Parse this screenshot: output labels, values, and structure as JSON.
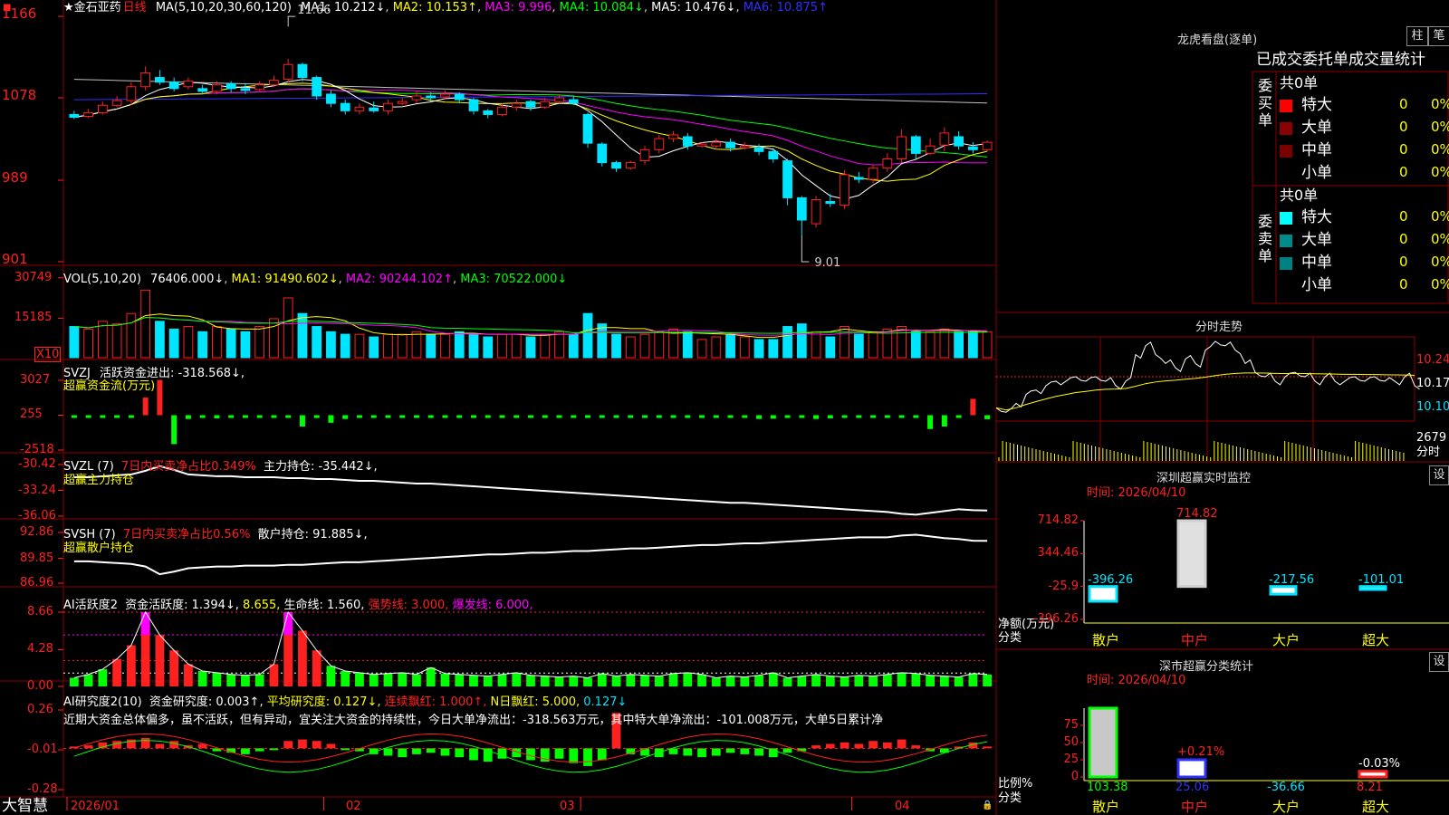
{
  "stock": {
    "star": "★",
    "name": "金石亚药",
    "period": "日线"
  },
  "colors": {
    "up": "#ff2020",
    "down": "#00e5ff",
    "green": "#00ff00",
    "white": "#ffffff",
    "yellow": "#ffff00",
    "magenta": "#ff00ff",
    "blue": "#3030ff",
    "grid": "#8b0000",
    "gray": "#c0c0c0"
  },
  "price_panel": {
    "ma_title": "MA(5,10,20,30,60,120)",
    "ma1": "MA1: 10.212↓",
    "ma2": "MA2: 10.153↑",
    "ma3": "MA3: 9.996",
    "ma4": "MA4: 10.084↓",
    "ma5": "MA5: 10.476↓",
    "ma6": "MA6: 10.875↑",
    "yticks": [
      "1166",
      "1078",
      "989",
      "901"
    ],
    "high_label": "11.66",
    "low_label": "9.01"
  },
  "vol_panel": {
    "title": "VOL(5,10,20)",
    "value": "76406.000↓",
    "ma1": "MA1: 91490.602↓",
    "ma2": "MA2: 90244.102↑",
    "ma3": "MA3: 70522.000↓",
    "yticks": [
      "30749",
      "15185"
    ],
    "unit": "X10"
  },
  "svzj_panel": {
    "title": "SVZJ",
    "label": "活跃资金进出: -318.568↓,",
    "sub": "超赢资金流(万元)",
    "yticks": [
      "3027",
      "255",
      "-2518"
    ]
  },
  "svzl_panel": {
    "title": "SVZL (7)",
    "label1": "7日内买卖净占比0.349%",
    "label2": "主力持仓: -35.442↓,",
    "sub": "超赢主力持仓",
    "yticks": [
      "-30.42",
      "-33.24",
      "-36.06"
    ]
  },
  "svsh_panel": {
    "title": "SVSH (7)",
    "label1": "7日内买卖净占比0.56%",
    "label2": "散户持仓: 91.885↓,",
    "sub": "超赢散户持仓",
    "yticks": [
      "92.86",
      "89.85",
      "86.96"
    ]
  },
  "ai_act_panel": {
    "title": "AI活跃度2",
    "l1": "资金活跃度: 1.394↓,",
    "l2": "8.655,",
    "l3": "生命线: 1.560,",
    "l4": "强势线: 3.000,",
    "l5": "爆发线: 6.000,",
    "yticks": [
      "8.66",
      "4.28",
      "0.00"
    ]
  },
  "ai_res_panel": {
    "title": "AI研究度2(10)",
    "l1": "资金研究度: 0.003↑,",
    "l2": "平均研究度: 0.127↓,",
    "l3": "连续飘红: 1.000↑,",
    "l4": "N日飘红: 5.000,",
    "l5": "0.127↓",
    "comment": "近期大资金总体偏多，虽不活跃，但有异动，宜关注大资金的持续性，今日大单净流出：-318.563万元，其中特大单净流出：-101.008万元，大单5日累计净",
    "yticks": [
      "0.26",
      "-0.01",
      "-0.28"
    ]
  },
  "xaxis": {
    "brand": "大智慧",
    "labels": [
      "2026/01",
      "02",
      "03",
      "04"
    ]
  },
  "longhu": {
    "title": "龙虎看盘(逐单)",
    "btn_bar": "柱",
    "btn_pen": "笔",
    "header": "已成交委托单成交量统计",
    "buy": {
      "side": "委买单",
      "total": "共0单",
      "rows": [
        {
          "label": "特大",
          "n": "0",
          "p": "0%"
        },
        {
          "label": "大单",
          "n": "0",
          "p": "0%"
        },
        {
          "label": "中单",
          "n": "0",
          "p": "0%"
        },
        {
          "label": "小单",
          "n": "0",
          "p": "0%"
        }
      ]
    },
    "sell": {
      "side": "委卖单",
      "total": "共0单",
      "rows": [
        {
          "label": "特大",
          "n": "0",
          "p": "0%"
        },
        {
          "label": "大单",
          "n": "0",
          "p": "0%"
        },
        {
          "label": "中单",
          "n": "0",
          "p": "0%"
        },
        {
          "label": "小单",
          "n": "0",
          "p": "0%"
        }
      ]
    }
  },
  "intraday": {
    "title": "分时走势",
    "yticks": [
      "10.24",
      "10.17",
      "10.10"
    ],
    "vol_label": "2679",
    "vol_unit": "分时"
  },
  "monitor": {
    "title": "深圳超赢实时监控",
    "set": "设",
    "time": "时间: 2026/04/10",
    "yticks": [
      "714.82",
      "344.46",
      "-25.9",
      "-396.26"
    ],
    "ylabel": "净额(万元)",
    "xlabel": "分类",
    "bars": [
      {
        "cat": "散户",
        "value": "-396.26"
      },
      {
        "cat": "中户",
        "value": "714.82"
      },
      {
        "cat": "大户",
        "value": "-217.56"
      },
      {
        "cat": "超大",
        "value": "-101.01"
      }
    ]
  },
  "classify": {
    "title": "深市超赢分类统计",
    "set": "设",
    "time": "时间: 2026/04/10",
    "yticks": [
      "75",
      "50",
      "25",
      "0"
    ],
    "ylabel": "比例%",
    "xlabel": "分类",
    "bars": [
      {
        "cat": "散户",
        "value": "103.38",
        "delta": ""
      },
      {
        "cat": "中户",
        "value": "25.06",
        "delta": "+0.21%"
      },
      {
        "cat": "大户",
        "value": "-36.66",
        "delta": ""
      },
      {
        "cat": "超大",
        "value": "8.21",
        "delta": "-0.03%"
      }
    ]
  },
  "chart_data": {
    "type": "candlestick",
    "candles": [
      [
        10.6,
        10.57,
        10.64,
        10.55
      ],
      [
        10.58,
        10.62,
        10.66,
        10.56
      ],
      [
        10.62,
        10.7,
        10.74,
        10.6
      ],
      [
        10.7,
        10.75,
        10.8,
        10.68
      ],
      [
        10.75,
        10.9,
        10.95,
        10.7
      ],
      [
        10.9,
        11.05,
        11.12,
        10.86
      ],
      [
        11.0,
        10.95,
        11.08,
        10.92
      ],
      [
        10.95,
        10.88,
        11.0,
        10.85
      ],
      [
        10.9,
        10.96,
        11.0,
        10.87
      ],
      [
        10.88,
        10.85,
        10.92,
        10.82
      ],
      [
        10.85,
        10.92,
        10.96,
        10.82
      ],
      [
        10.93,
        10.88,
        10.96,
        10.84
      ],
      [
        10.88,
        10.86,
        10.94,
        10.82
      ],
      [
        10.87,
        10.92,
        10.96,
        10.85
      ],
      [
        10.92,
        10.97,
        11.02,
        10.9
      ],
      [
        10.98,
        11.14,
        11.2,
        10.95
      ],
      [
        11.14,
        11.0,
        11.16,
        10.96
      ],
      [
        11.0,
        10.8,
        11.02,
        10.76
      ],
      [
        10.82,
        10.72,
        10.86,
        10.68
      ],
      [
        10.72,
        10.64,
        10.76,
        10.6
      ],
      [
        10.64,
        10.68,
        10.72,
        10.6
      ],
      [
        10.67,
        10.64,
        10.74,
        10.62
      ],
      [
        10.64,
        10.72,
        10.76,
        10.6
      ],
      [
        10.72,
        10.74,
        10.78,
        10.7
      ],
      [
        10.76,
        10.8,
        10.86,
        10.72
      ],
      [
        10.8,
        10.78,
        10.84,
        10.74
      ],
      [
        10.79,
        10.82,
        10.86,
        10.76
      ],
      [
        10.82,
        10.76,
        10.84,
        10.72
      ],
      [
        10.76,
        10.64,
        10.78,
        10.6
      ],
      [
        10.64,
        10.6,
        10.66,
        10.56
      ],
      [
        10.6,
        10.68,
        10.72,
        10.58
      ],
      [
        10.68,
        10.72,
        10.76,
        10.64
      ],
      [
        10.74,
        10.68,
        10.76,
        10.64
      ],
      [
        10.68,
        10.74,
        10.78,
        10.66
      ],
      [
        10.74,
        10.78,
        10.82,
        10.72
      ],
      [
        10.76,
        10.72,
        10.8,
        10.7
      ],
      [
        10.6,
        10.29,
        10.62,
        10.24
      ],
      [
        10.28,
        10.08,
        10.3,
        10.04
      ],
      [
        10.08,
        10.02,
        10.1,
        9.98
      ],
      [
        10.02,
        10.08,
        10.1,
        10.0
      ],
      [
        10.1,
        10.22,
        10.26,
        10.06
      ],
      [
        10.22,
        10.34,
        10.38,
        10.18
      ],
      [
        10.34,
        10.38,
        10.42,
        10.3
      ],
      [
        10.36,
        10.26,
        10.4,
        10.22
      ],
      [
        10.26,
        10.28,
        10.3,
        10.24
      ],
      [
        10.26,
        10.3,
        10.34,
        10.22
      ],
      [
        10.3,
        10.24,
        10.34,
        10.2
      ],
      [
        10.24,
        10.26,
        10.3,
        10.22
      ],
      [
        10.24,
        10.2,
        10.28,
        10.16
      ],
      [
        10.2,
        10.12,
        10.24,
        10.08
      ],
      [
        10.1,
        9.7,
        10.12,
        9.62
      ],
      [
        9.7,
        9.46,
        9.72,
        9.3
      ],
      [
        9.42,
        9.68,
        9.72,
        9.38
      ],
      [
        9.66,
        9.64,
        9.74,
        9.6
      ],
      [
        9.62,
        9.95,
        10.0,
        9.58
      ],
      [
        9.92,
        9.9,
        9.98,
        9.86
      ],
      [
        9.9,
        10.02,
        10.06,
        9.86
      ],
      [
        10.02,
        10.12,
        10.18,
        9.98
      ],
      [
        10.12,
        10.36,
        10.44,
        10.08
      ],
      [
        10.36,
        10.18,
        10.38,
        10.12
      ],
      [
        10.18,
        10.26,
        10.34,
        10.16
      ],
      [
        10.27,
        10.4,
        10.46,
        10.2
      ],
      [
        10.36,
        10.26,
        10.42,
        10.22
      ],
      [
        10.25,
        10.22,
        10.3,
        10.18
      ],
      [
        10.22,
        10.3,
        10.32,
        10.2
      ]
    ],
    "volume": [
      12,
      11,
      14,
      13,
      17,
      26,
      14,
      11,
      12,
      10,
      12,
      11,
      10,
      12,
      15,
      23,
      17,
      12,
      10,
      9,
      9,
      8,
      9,
      9,
      10,
      9,
      9,
      10,
      9,
      8,
      9,
      9,
      8,
      9,
      10,
      9,
      17,
      13,
      9,
      8,
      9,
      10,
      11,
      10,
      7,
      8,
      9,
      8,
      7,
      7,
      12,
      13,
      10,
      8,
      12,
      9,
      10,
      11,
      12,
      10,
      10,
      11,
      10,
      10,
      10
    ],
    "active_flow": [
      -50,
      -40,
      -30,
      -20,
      -10,
      1400,
      2800,
      -2300,
      -300,
      -200,
      -250,
      -200,
      -180,
      -150,
      -160,
      -180,
      -900,
      -220,
      -600,
      -300,
      -160,
      -150,
      -170,
      -180,
      -150,
      -160,
      -170,
      -150,
      -160,
      -180,
      -170,
      -160,
      -150,
      -170,
      -180,
      -160,
      -170,
      -150,
      -160,
      -200,
      -180,
      -160,
      -170,
      -150,
      -170,
      -160,
      -150,
      -160,
      -300,
      -280,
      -150,
      -200,
      -300,
      -250,
      -160,
      -200,
      -170,
      -160,
      -180,
      -170,
      -1100,
      -900,
      -150,
      1300,
      -318
    ],
    "svzl": [
      -31.8,
      -31.8,
      -31.7,
      -31.6,
      -31.5,
      -31.1,
      -30.6,
      -31.0,
      -31.5,
      -31.6,
      -31.7,
      -31.7,
      -31.8,
      -31.8,
      -31.8,
      -31.9,
      -31.9,
      -32.0,
      -32.0,
      -32.1,
      -32.2,
      -32.2,
      -32.3,
      -32.4,
      -32.5,
      -32.5,
      -32.6,
      -32.7,
      -32.8,
      -32.9,
      -33.0,
      -33.1,
      -33.2,
      -33.3,
      -33.4,
      -33.5,
      -33.6,
      -33.7,
      -33.8,
      -33.9,
      -34.0,
      -34.1,
      -34.2,
      -34.3,
      -34.4,
      -34.5,
      -34.6,
      -34.6,
      -34.7,
      -34.8,
      -34.9,
      -35.0,
      -35.1,
      -35.2,
      -35.3,
      -35.4,
      -35.5,
      -35.6,
      -35.8,
      -35.9,
      -35.7,
      -35.5,
      -35.3,
      -35.4,
      -35.44
    ],
    "svsh": [
      89.5,
      89.5,
      89.4,
      89.3,
      89.2,
      88.9,
      88.0,
      88.3,
      88.7,
      88.8,
      88.9,
      88.9,
      89.0,
      89.0,
      89.0,
      89.1,
      89.1,
      89.2,
      89.3,
      89.4,
      89.4,
      89.5,
      89.6,
      89.7,
      89.8,
      89.9,
      90.0,
      90.1,
      90.2,
      90.3,
      90.3,
      90.4,
      90.5,
      90.5,
      90.6,
      90.7,
      90.7,
      90.8,
      90.9,
      91.0,
      91.0,
      91.1,
      91.2,
      91.3,
      91.4,
      91.4,
      91.5,
      91.6,
      91.6,
      91.7,
      91.8,
      91.9,
      92.0,
      92.1,
      92.2,
      92.3,
      92.3,
      92.3,
      92.5,
      92.6,
      92.4,
      92.2,
      92.1,
      91.9,
      91.885
    ],
    "ai_activity": [
      1.0,
      1.4,
      2.0,
      3.2,
      4.8,
      8.66,
      6.0,
      4.2,
      2.6,
      1.8,
      1.6,
      1.4,
      1.3,
      1.4,
      2.6,
      8.66,
      6.5,
      4.2,
      2.4,
      1.8,
      1.6,
      1.4,
      1.5,
      1.6,
      1.4,
      2.2,
      1.5,
      1.4,
      1.3,
      1.2,
      1.4,
      1.6,
      1.3,
      1.2,
      1.1,
      1.2,
      1.0,
      1.5,
      1.2,
      1.4,
      1.3,
      1.2,
      1.5,
      1.6,
      1.4,
      1.0,
      1.2,
      1.1,
      1.3,
      1.6,
      1.0,
      1.2,
      1.4,
      1.2,
      1.1,
      1.3,
      1.2,
      1.4,
      1.6,
      1.5,
      1.3,
      1.2,
      1.1,
      1.5,
      1.394
    ],
    "ai_research": [
      0.0,
      0.02,
      0.04,
      0.05,
      0.06,
      0.07,
      0.03,
      0.05,
      0.02,
      0.03,
      -0.02,
      -0.03,
      -0.04,
      -0.02,
      -0.01,
      0.05,
      0.06,
      0.05,
      0.03,
      -0.01,
      -0.02,
      -0.04,
      -0.05,
      -0.06,
      -0.04,
      -0.03,
      -0.05,
      -0.06,
      -0.08,
      -0.09,
      -0.07,
      -0.06,
      -0.08,
      -0.09,
      -0.07,
      -0.1,
      -0.12,
      -0.08,
      0.24,
      -0.04,
      -0.05,
      -0.06,
      -0.04,
      -0.05,
      -0.06,
      -0.05,
      -0.03,
      -0.04,
      -0.05,
      -0.06,
      -0.03,
      -0.02,
      0.02,
      0.03,
      0.04,
      0.03,
      0.05,
      0.04,
      0.06,
      0.02,
      -0.02,
      -0.03,
      0.01,
      0.04,
      0.003
    ],
    "intraday": [
      10.1,
      10.09,
      10.11,
      10.13,
      10.14,
      10.15,
      10.16,
      10.16,
      10.17,
      10.16,
      10.17,
      10.16,
      10.15,
      10.16,
      10.22,
      10.24,
      10.22,
      10.2,
      10.19,
      10.21,
      10.2,
      10.23,
      10.25,
      10.24,
      10.23,
      10.2,
      10.18,
      10.17,
      10.16,
      10.17,
      10.18,
      10.17,
      10.16,
      10.17,
      10.16,
      10.16,
      10.17,
      10.16,
      10.17,
      10.16,
      10.16,
      10.17,
      10.15
    ]
  }
}
